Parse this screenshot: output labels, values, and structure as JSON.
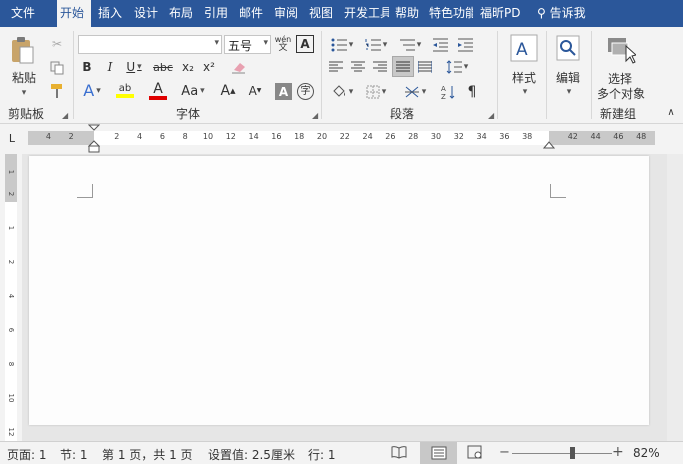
{
  "tabs": {
    "file": "文件",
    "home": "开始",
    "insert": "插入",
    "design": "设计",
    "layout": "布局",
    "references": "引用",
    "mailings": "邮件",
    "review": "审阅",
    "view": "视图",
    "developer": "开发工具",
    "help": "帮助",
    "features": "特色功能",
    "foxit_pdf": "福昕PD",
    "tell_me": "告诉我"
  },
  "clipboard": {
    "paste_label": "粘贴",
    "group_label": "剪贴板"
  },
  "font": {
    "name_value": "",
    "size_value": "五号",
    "phonetic_glyph": "wén",
    "bold": "B",
    "italic": "I",
    "underline": "U",
    "strikethrough": "abc",
    "subscript": "x₂",
    "superscript": "x²",
    "text_effect": "A",
    "highlight": "ab",
    "font_color": "A",
    "change_case": "Aa",
    "grow": "A",
    "shrink": "A",
    "char_shading": "A",
    "enclose_char": "字",
    "border_char": "A",
    "group_label": "字体"
  },
  "paragraph": {
    "group_label": "段落"
  },
  "styles": {
    "label": "样式"
  },
  "editing": {
    "label": "编辑"
  },
  "newgroup": {
    "select_line1": "选择",
    "select_line2": "多个对象",
    "group_label": "新建组"
  },
  "ruler": {
    "tab_selector": "L",
    "h_left": [
      "4",
      "2"
    ],
    "h_right": [
      "2",
      "4",
      "6",
      "8",
      "10",
      "12",
      "14",
      "16",
      "18",
      "20",
      "22",
      "24",
      "26",
      "28",
      "30",
      "32",
      "34",
      "36",
      "38"
    ],
    "h_margin": [
      "42",
      "44",
      "46",
      "48"
    ],
    "v_marks": [
      "1",
      "2",
      "1",
      "2",
      "4",
      "6",
      "8",
      "10",
      "12"
    ]
  },
  "status": {
    "page": "页面: 1",
    "section": "节: 1",
    "page_of": "第 1 页，共 1 页",
    "position": "设置值: 2.5厘米",
    "line": "行: 1",
    "zoom": "82%",
    "zoom_fraction": 0.6
  },
  "colors": {
    "accent": "#2b579a",
    "highlight_yellow": "#ffff00",
    "font_red": "#e00000"
  }
}
